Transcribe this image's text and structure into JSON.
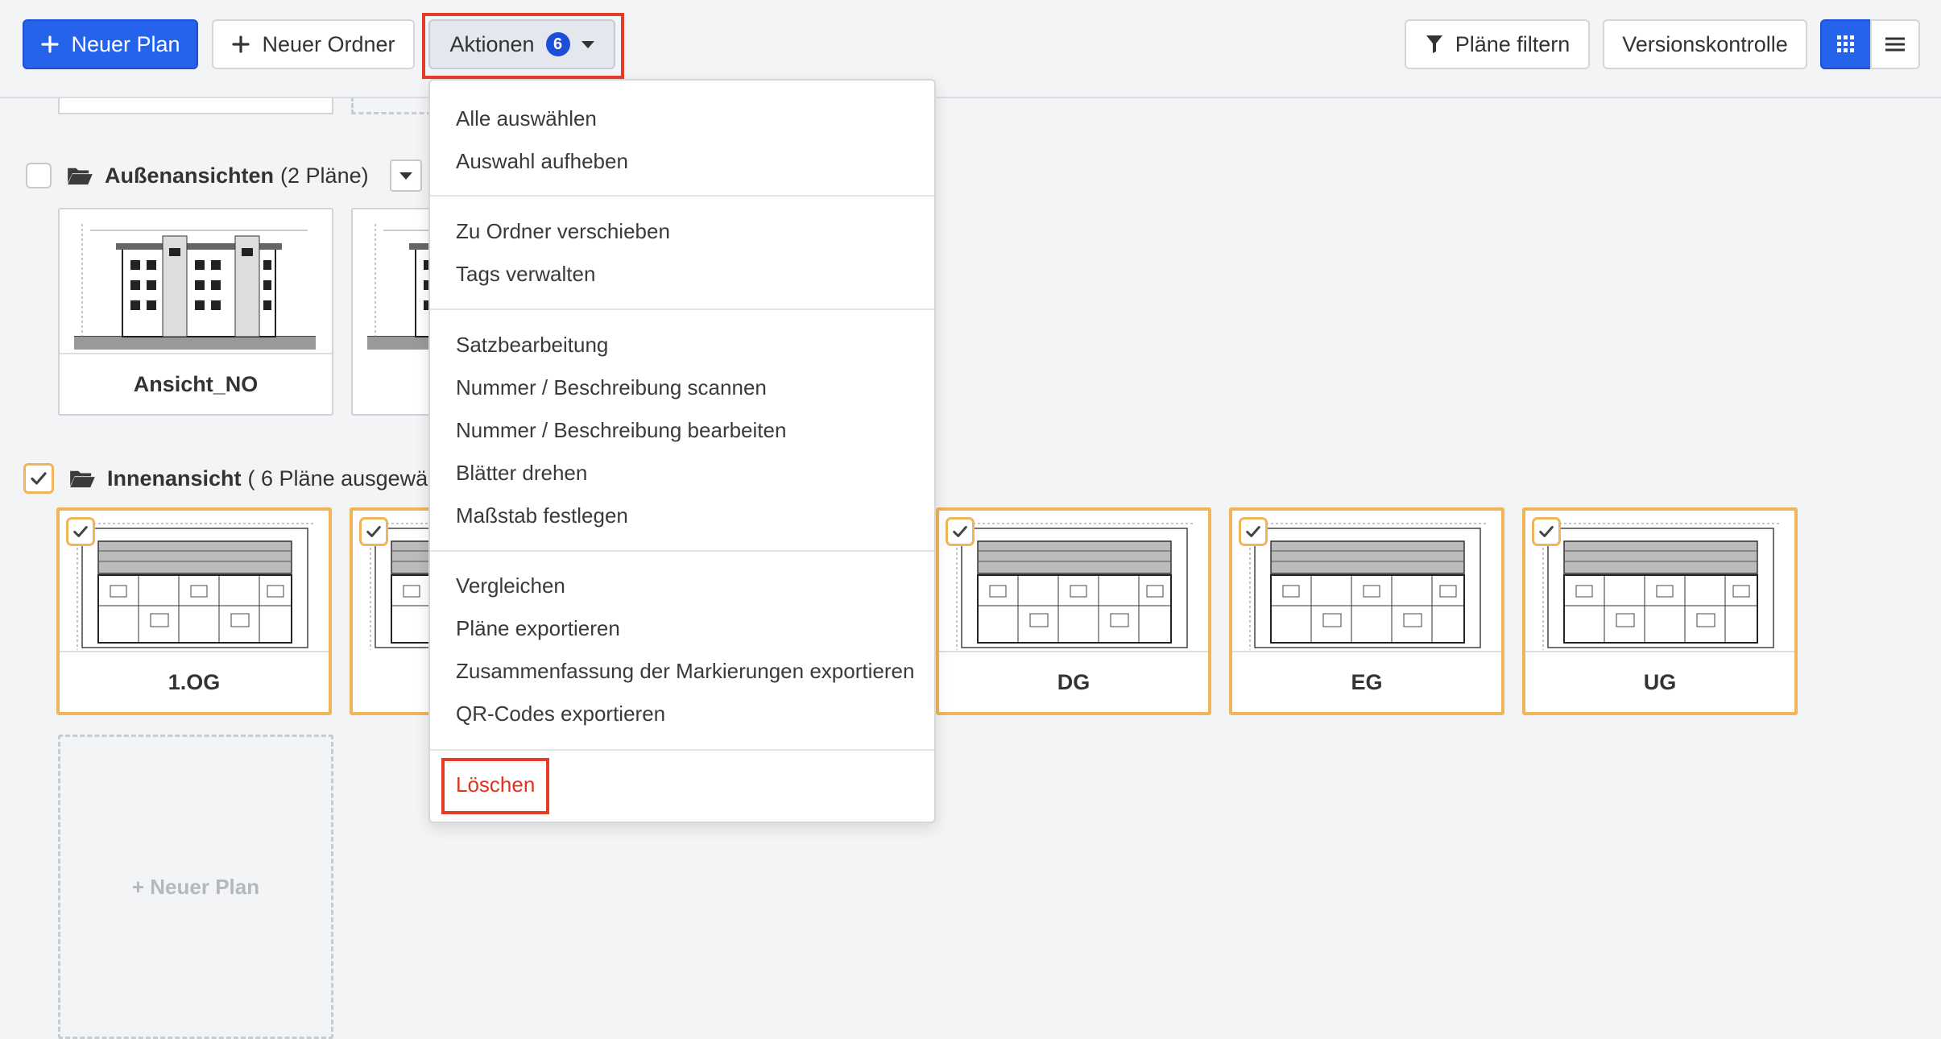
{
  "toolbar": {
    "new_plan": "Neuer Plan",
    "new_folder": "Neuer Ordner",
    "actions": "Aktionen",
    "actions_count": "6",
    "filter": "Pläne filtern",
    "version_control": "Versionskontrolle",
    "view_grid_icon": "grid-icon",
    "view_list_icon": "list-icon"
  },
  "menu": {
    "group1": [
      "Alle auswählen",
      "Auswahl aufheben"
    ],
    "group2": [
      "Zu Ordner verschieben",
      "Tags verwalten"
    ],
    "group3": [
      "Satzbearbeitung",
      "Nummer / Beschreibung scannen",
      "Nummer / Beschreibung bearbeiten",
      "Blätter drehen",
      "Maßstab festlegen"
    ],
    "group4": [
      "Vergleichen",
      "Pläne exportieren",
      "Zusammenfassung der Markierungen exportieren",
      "QR-Codes exportieren"
    ],
    "delete": "Löschen"
  },
  "folders": {
    "exterior": {
      "name": "Außenansichten",
      "count": "(2 Pläne)",
      "plans": [
        "Ansicht_NO"
      ]
    },
    "interior": {
      "name": "Innenansicht",
      "count": "( 6 Pläne ausgewählt )",
      "plans": [
        "1.OG",
        "DG",
        "EG",
        "UG"
      ]
    }
  },
  "new_plan_placeholder": "+ Neuer Plan",
  "colors": {
    "primary": "#2563eb",
    "selected_border": "#f0b558",
    "highlight": "#e23b26",
    "danger": "#e0321d"
  }
}
